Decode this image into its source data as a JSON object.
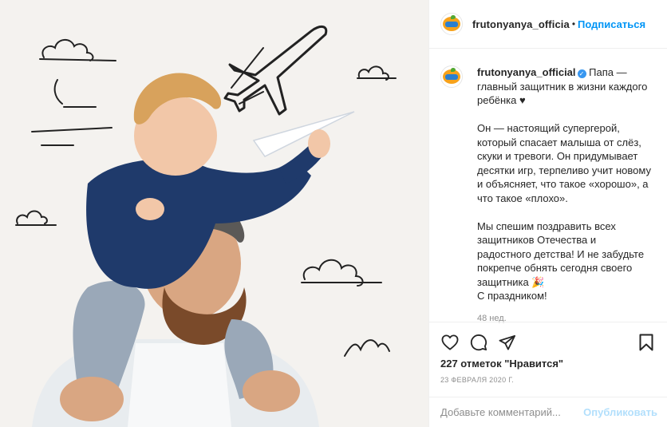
{
  "post": {
    "image_alt": "",
    "header": {
      "username": "frutonyanya_officia",
      "dot": "•",
      "follow_label": "Подписаться"
    },
    "caption": {
      "username": "frutonyanya_official",
      "verified_mark": "✓",
      "line1": "Папа — главный защитник в жизни каждого ребёнка ♥",
      "para2": "Он — настоящий супергерой, который спасает малыша от слёз, скуки и тревоги. Он придумывает десятки игр, терпеливо учит новому и объясняет, что такое «хорошо», а что такое «плохо».",
      "para3": "Мы спешим поздравить всех защитников Отечества и радостного детства! И не забудьте покрепче обнять сегодня  своего защитника 🎉",
      "para4": "С праздником!",
      "time": "48 нед."
    },
    "actions": {
      "like_icon": "heart-icon",
      "comment_icon": "comment-icon",
      "share_icon": "share-icon",
      "save_icon": "bookmark-icon"
    },
    "likes": "227 отметок \"Нравится\"",
    "date": "23 ФЕВРАЛЯ 2020 Г.",
    "comment": {
      "placeholder": "Добавьте комментарий...",
      "value": "",
      "publish_label": "Опубликовать"
    }
  },
  "colors": {
    "accent": "#0095f6",
    "publish_disabled": "#b2dffc",
    "photo_bg": "#f3f1ee"
  }
}
